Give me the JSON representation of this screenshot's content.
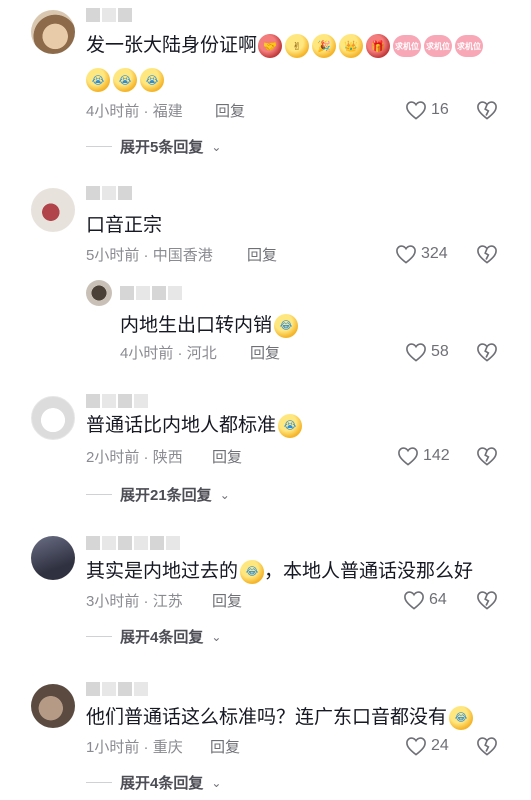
{
  "comments": [
    {
      "text": "发一张大陆身份证啊",
      "emojis_line1": [
        "🤝",
        "✌",
        "🎉",
        "👑",
        "🎁",
        "求机位",
        "求机位",
        "求机位"
      ],
      "emojis_line2": [
        "😭",
        "😭",
        "😭"
      ],
      "time": "4小时前",
      "location": "福建",
      "reply_label": "回复",
      "likes": "16",
      "expand_label": "展开5条回复"
    },
    {
      "text": "口音正宗",
      "time": "5小时前",
      "location": "中国香港",
      "reply_label": "回复",
      "likes": "324",
      "reply": {
        "text": "内地生出口转内销",
        "time": "4小时前",
        "location": "河北",
        "reply_label": "回复",
        "likes": "58"
      }
    },
    {
      "text": "普通话比内地人都标准",
      "time": "2小时前",
      "location": "陕西",
      "reply_label": "回复",
      "likes": "142",
      "expand_label": "展开21条回复"
    },
    {
      "text_before": "其实是内地过去的",
      "text_after": "，本地人普通话没那么好",
      "time": "3小时前",
      "location": "江苏",
      "reply_label": "回复",
      "likes": "64",
      "expand_label": "展开4条回复"
    },
    {
      "text": "他们普通话这么标准吗？连广东口音都没有",
      "time": "1小时前",
      "location": "重庆",
      "reply_label": "回复",
      "likes": "24",
      "expand_label": "展开4条回复"
    }
  ],
  "meta_separator": " · ",
  "icons": {
    "like": "heart-outline-icon",
    "dislike": "broken-heart-icon",
    "expand": "chevron-down-icon"
  }
}
